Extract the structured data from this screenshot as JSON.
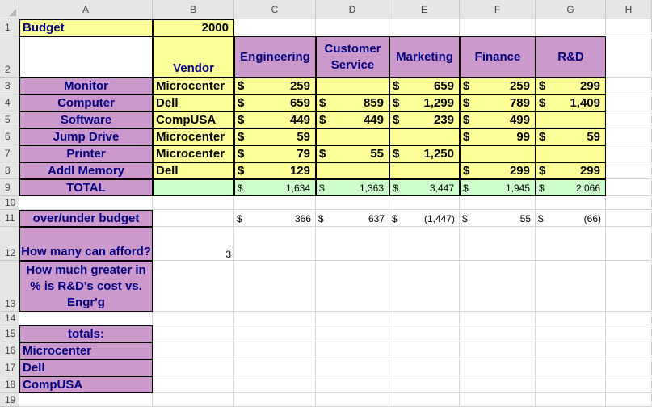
{
  "columns": [
    "A",
    "B",
    "C",
    "D",
    "E",
    "F",
    "G",
    "H"
  ],
  "rows": [
    "1",
    "2",
    "3",
    "4",
    "5",
    "6",
    "7",
    "8",
    "9",
    "10",
    "11",
    "12",
    "13",
    "14",
    "15",
    "16",
    "17",
    "18",
    "19"
  ],
  "r1": {
    "title": "Budget",
    "amount": "2000"
  },
  "headers": {
    "vendor": "Vendor",
    "engineering": "Engineering",
    "customer_service": "Customer Service",
    "marketing": "Marketing",
    "finance": "Finance",
    "rd": "R&D"
  },
  "currency": "$",
  "items": [
    {
      "name": "Monitor",
      "vendor": "Microcenter",
      "eng": "259",
      "cs": "",
      "mkt": "659",
      "fin": "259",
      "rd": "299"
    },
    {
      "name": "Computer",
      "vendor": "Dell",
      "eng": "659",
      "cs": "859",
      "mkt": "1,299",
      "fin": "789",
      "rd": "1,409"
    },
    {
      "name": "Software",
      "vendor": "CompUSA",
      "eng": "449",
      "cs": "449",
      "mkt": "239",
      "fin": "499",
      "rd": ""
    },
    {
      "name": "Jump Drive",
      "vendor": "Microcenter",
      "eng": "59",
      "cs": "",
      "mkt": "",
      "fin": "99",
      "rd": "59"
    },
    {
      "name": "Printer",
      "vendor": "Microcenter",
      "eng": "79",
      "cs": "55",
      "mkt": "1,250",
      "fin": "",
      "rd": ""
    },
    {
      "name": "Addl Memory",
      "vendor": "Dell",
      "eng": "129",
      "cs": "",
      "mkt": "",
      "fin": "299",
      "rd": "299"
    }
  ],
  "total": {
    "label": "TOTAL",
    "eng": "1,634",
    "cs": "1,363",
    "mkt": "3,447",
    "fin": "1,945",
    "rd": "2,066"
  },
  "over_under": {
    "label": "over/under budget",
    "eng": "366",
    "cs": "637",
    "mkt": "(1,447)",
    "fin": "55",
    "rd": "(66)"
  },
  "afford": {
    "label": "How many can afford?",
    "value": "3"
  },
  "pct_label": "How much greater in % is R&D's cost vs. Engr'g",
  "totals_label": "totals:",
  "vendor_totals": [
    "Microcenter",
    "Dell",
    "CompUSA"
  ]
}
